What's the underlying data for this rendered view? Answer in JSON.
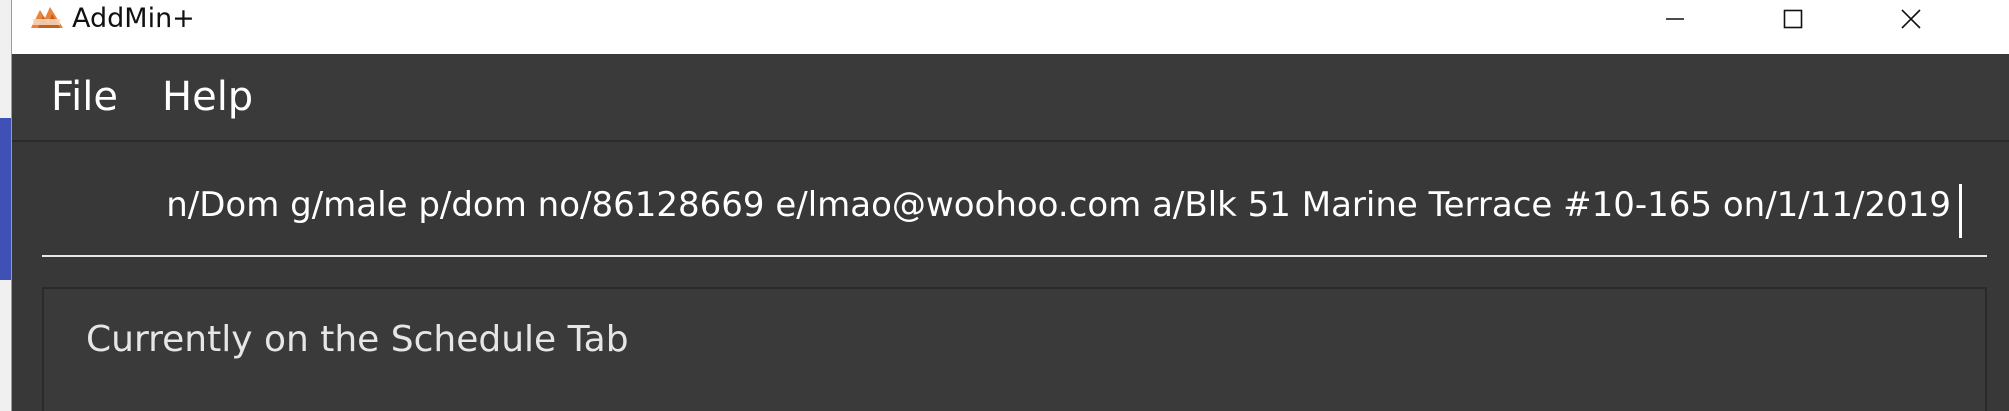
{
  "window": {
    "title": "AddMin+",
    "logo_icon": "addmin-mountain-logo-icon",
    "controls": {
      "minimize_icon": "minimize-icon",
      "maximize_icon": "maximize-icon",
      "close_icon": "close-icon"
    }
  },
  "menu": {
    "items": [
      {
        "label": "File"
      },
      {
        "label": "Help"
      }
    ]
  },
  "command_box": {
    "value": "n/Dom g/male p/dom no/86128669 e/lmao@woohoo.com a/Blk 51 Marine Terrace #10-165 on/1/11/2019"
  },
  "result_display": {
    "text": "Currently on the Schedule Tab"
  },
  "colors": {
    "menu_bg": "#3a3a3a",
    "content_bg": "#383838",
    "logo_orange": "#e8833a",
    "backdrop_accent": "#3f51b5"
  }
}
